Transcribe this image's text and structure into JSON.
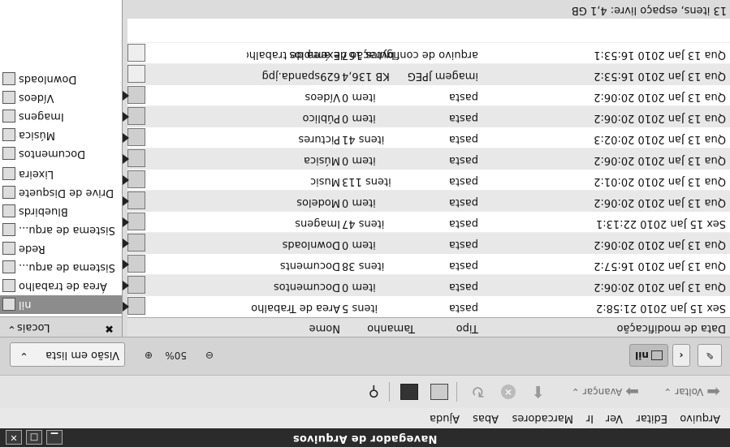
{
  "window": {
    "title": "Navegador de Arquivos"
  },
  "menu": [
    "Arquivo",
    "Editar",
    "Ver",
    "Ir",
    "Marcadores",
    "Abas",
    "Ajuda"
  ],
  "toolbar": {
    "back": "Voltar",
    "forward": "Avançar"
  },
  "location": {
    "current_folder": "nil",
    "zoom": "50%",
    "view_mode": "Visão em lista"
  },
  "sidebar": {
    "header": "Locais",
    "items": [
      "nil",
      "Área de trabalho",
      "Sistema de arqu...",
      "Rede",
      "Sistema de arqu...",
      "Bluebirds",
      "Drive de Disquete",
      "Lixeira",
      "Documentos",
      "Música",
      "Imagens",
      "Vídeos",
      "Downloads"
    ]
  },
  "columns": {
    "name": "Nome",
    "size": "Tamanho",
    "type": "Tipo",
    "date": "Data de modificação"
  },
  "files": [
    {
      "name": "Área de Trabalho",
      "size": "5 itens",
      "type": "pasta",
      "date": "Sex 15 Jan 2010 21:58:2"
    },
    {
      "name": "Documentos",
      "size": "0 item",
      "type": "pasta",
      "date": "Qua 13 Jan 2010 20:06:2"
    },
    {
      "name": "Documents",
      "size": "38 itens",
      "type": "pasta",
      "date": "Qua 13 Jan 2010 16:57:2"
    },
    {
      "name": "Downloads",
      "size": "0 item",
      "type": "pasta",
      "date": "Qua 13 Jan 2010 20:06:2"
    },
    {
      "name": "Imagens",
      "size": "47 itens",
      "type": "pasta",
      "date": "Sex 15 Jan 2010 22:13:1"
    },
    {
      "name": "Modelos",
      "size": "0 item",
      "type": "pasta",
      "date": "Qua 13 Jan 2010 20:06:2"
    },
    {
      "name": "Music",
      "size": "113 itens",
      "type": "pasta",
      "date": "Qua 13 Jan 2010 20:01:2"
    },
    {
      "name": "Música",
      "size": "0 item",
      "type": "pasta",
      "date": "Qua 13 Jan 2010 20:06:2"
    },
    {
      "name": "Pictures",
      "size": "41 itens",
      "type": "pasta",
      "date": "Qua 13 Jan 2010 20:02:3"
    },
    {
      "name": "Público",
      "size": "0 item",
      "type": "pasta",
      "date": "Qua 13 Jan 2010 20:06:2"
    },
    {
      "name": "Vídeos",
      "size": "0 item",
      "type": "pasta",
      "date": "Qua 13 Jan 2010 20:06:2"
    },
    {
      "name": "629spanda.jpg",
      "size": "136,4 KB",
      "type": "imagem JPEG",
      "date": "Qua 13 Jan 2010 16:53:2"
    },
    {
      "name": "Exemplos",
      "size": "167 bytes",
      "type": "arquivo de configuração de área de trabalho",
      "date": "Qua 13 Jan 2010 16:53:1"
    }
  ],
  "status": "13 itens, espaço livre: 4,1 GB"
}
